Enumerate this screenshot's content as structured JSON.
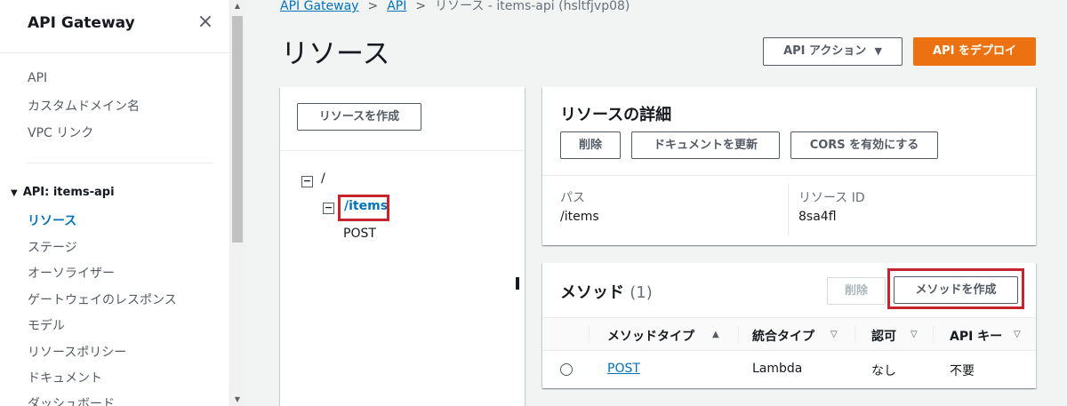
{
  "sidebar": {
    "title": "API Gateway",
    "close_glyph": "×",
    "top_links": [
      "API",
      "カスタムドメイン名",
      "VPC リンク"
    ],
    "group_label": "API: items-api",
    "group_items": [
      "リソース",
      "ステージ",
      "オーソライザー",
      "ゲートウェイのレスポンス",
      "モデル",
      "リソースポリシー",
      "ドキュメント",
      "ダッシュボード"
    ],
    "active_item": "リソース"
  },
  "breadcrumb": {
    "items": [
      "API Gateway",
      "API"
    ],
    "current": "リソース - items-api (hsltfjvp08)"
  },
  "page": {
    "title": "リソース"
  },
  "header_actions": {
    "api_actions_label": "API アクション",
    "deploy_label": "API をデプロイ"
  },
  "tree": {
    "create_resource_label": "リソースを作成",
    "root_label": "/",
    "items_label": "/items",
    "method_label": "POST",
    "expand_glyph": "⊟"
  },
  "resource_details": {
    "title": "リソースの詳細",
    "delete_label": "削除",
    "update_docs_label": "ドキュメントを更新",
    "cors_label": "CORS を有効にする",
    "path_label": "パス",
    "path_value": "/items",
    "resource_id_label": "リソース ID",
    "resource_id_value": "8sa4fl"
  },
  "methods": {
    "title": "メソッド",
    "count": "(1)",
    "delete_label": "削除",
    "create_label": "メソッドを作成",
    "columns": [
      "メソッドタイプ",
      "統合タイプ",
      "認可",
      "API キー"
    ],
    "rows": [
      {
        "method_type": "POST",
        "integration_type": "Lambda",
        "authorization": "なし",
        "api_key": "不要"
      }
    ]
  },
  "colors": {
    "accent": "#0073bb",
    "deploy_button": "#ec7211",
    "highlight_box": "#c7252e"
  }
}
